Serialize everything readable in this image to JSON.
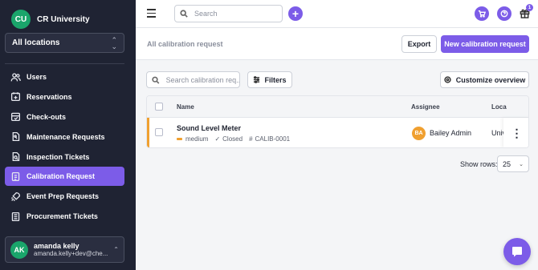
{
  "org": {
    "logo_initials": "CU",
    "name": "CR University"
  },
  "location_select": {
    "value": "All locations"
  },
  "sidebar": {
    "items": [
      {
        "label": "Users",
        "icon": "users-icon",
        "active": false
      },
      {
        "label": "Reservations",
        "icon": "calendar-plus-icon",
        "active": false
      },
      {
        "label": "Check-outs",
        "icon": "checkout-icon",
        "active": false
      },
      {
        "label": "Maintenance Requests",
        "icon": "document-wrench-icon",
        "active": false
      },
      {
        "label": "Inspection Tickets",
        "icon": "inspection-icon",
        "active": false
      },
      {
        "label": "Calibration Request",
        "icon": "clipboard-icon",
        "active": true
      },
      {
        "label": "Event Prep Requests",
        "icon": "rocket-icon",
        "active": false
      },
      {
        "label": "Procurement Tickets",
        "icon": "list-document-icon",
        "active": false
      }
    ]
  },
  "user": {
    "initials": "AK",
    "name": "amanda kelly",
    "email": "amanda.kelly+dev@che..."
  },
  "topbar": {
    "search_placeholder": "Search",
    "gift_badge": "1"
  },
  "header": {
    "title": "All calibration request",
    "export_label": "Export",
    "new_label": "New calibration request"
  },
  "toolbar": {
    "search_placeholder": "Search calibration req...",
    "filters_label": "Filters",
    "customize_label": "Customize overview"
  },
  "table": {
    "columns": {
      "name": "Name",
      "assignee": "Assignee",
      "location": "Loca"
    },
    "rows": [
      {
        "name": "Sound Level Meter",
        "priority": "medium",
        "status": "Closed",
        "id": "CALIB-0001",
        "assignee_initials": "BA",
        "assignee": "Bailey Admin",
        "location": "Univ"
      }
    ]
  },
  "pagination": {
    "label": "Show rows:",
    "value": "25"
  },
  "colors": {
    "accent": "#7c5ce8",
    "sidebar": "#1f2333",
    "priority_medium": "#f0a030",
    "avatar_green": "#1aa56b"
  }
}
